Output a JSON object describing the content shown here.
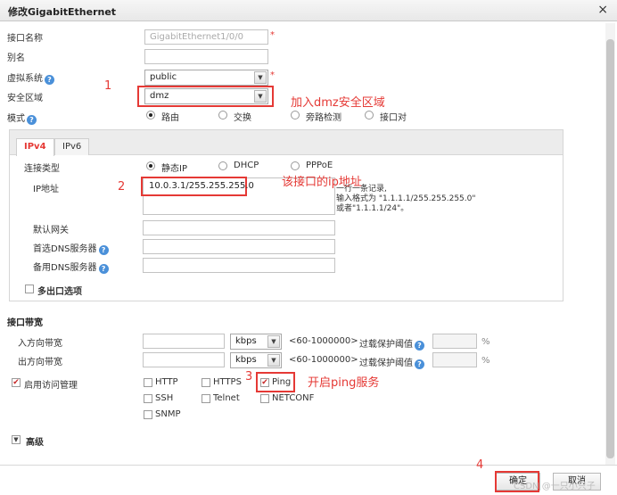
{
  "dialog": {
    "title": "修改GigabitEthernet",
    "close_glyph": "×"
  },
  "form": {
    "interface_name_label": "接口名称",
    "interface_name_value": "GigabitEthernet1/0/0",
    "alias_label": "别名",
    "alias_value": "",
    "vsys_label": "虚拟系统",
    "vsys_value": "public",
    "zone_label": "安全区域",
    "zone_value": "dmz",
    "mode_label": "模式",
    "mode_options": [
      "路由",
      "交换",
      "旁路检测",
      "接口对"
    ],
    "mode_selected": "路由",
    "required_mark": "*",
    "help_glyph": "?"
  },
  "tabs": [
    {
      "label": "IPv4",
      "active": true
    },
    {
      "label": "IPv6",
      "active": false
    }
  ],
  "ipv4": {
    "conn_type_label": "连接类型",
    "conn_options": [
      "静态IP",
      "DHCP",
      "PPPoE"
    ],
    "conn_selected": "静态IP",
    "ip_label": "IP地址",
    "ip_value": "10.0.3.1/255.255.255.0",
    "ip_hint_line1": "一行一条记录,",
    "ip_hint_line2": "输入格式为 \"1.1.1.1/255.255.255.0\"",
    "ip_hint_line3": "或者\"1.1.1.1/24\"。",
    "gateway_label": "默认网关",
    "dns1_label": "首选DNS服务器",
    "dns2_label": "备用DNS服务器",
    "multi_exit_label": "多出口选项"
  },
  "bandwidth": {
    "section_label": "接口带宽",
    "in_label": "入方向带宽",
    "out_label": "出方向带宽",
    "unit": "kbps",
    "range": "<60-1000000>",
    "overload_label": "过载保护阈值",
    "percent": "%"
  },
  "access": {
    "enable_label": "启用访问管理",
    "enabled": true,
    "services": [
      {
        "label": "HTTP",
        "checked": false
      },
      {
        "label": "HTTPS",
        "checked": false
      },
      {
        "label": "Ping",
        "checked": true
      },
      {
        "label": "SSH",
        "checked": false
      },
      {
        "label": "Telnet",
        "checked": false
      },
      {
        "label": "NETCONF",
        "checked": false
      },
      {
        "label": "SNMP",
        "checked": false
      }
    ]
  },
  "advanced_label": "高级",
  "buttons": {
    "ok": "确定",
    "cancel": "取消"
  },
  "annotations": {
    "n1": "1",
    "t1": "加入dmz安全区域",
    "n2": "2",
    "t2": "该接口的ip地址",
    "n3": "3",
    "t3": "开启ping服务",
    "n4": "4"
  },
  "watermark": "CSDN @一只小只子",
  "colors": {
    "annotation_red": "#e53935",
    "help_blue": "#4a90d9",
    "tab_active": "#e53935"
  },
  "icons": {
    "help": "question-circle-icon",
    "close": "close-icon",
    "dropdown": "chevron-down-icon",
    "collapse": "triangle-down-icon"
  }
}
